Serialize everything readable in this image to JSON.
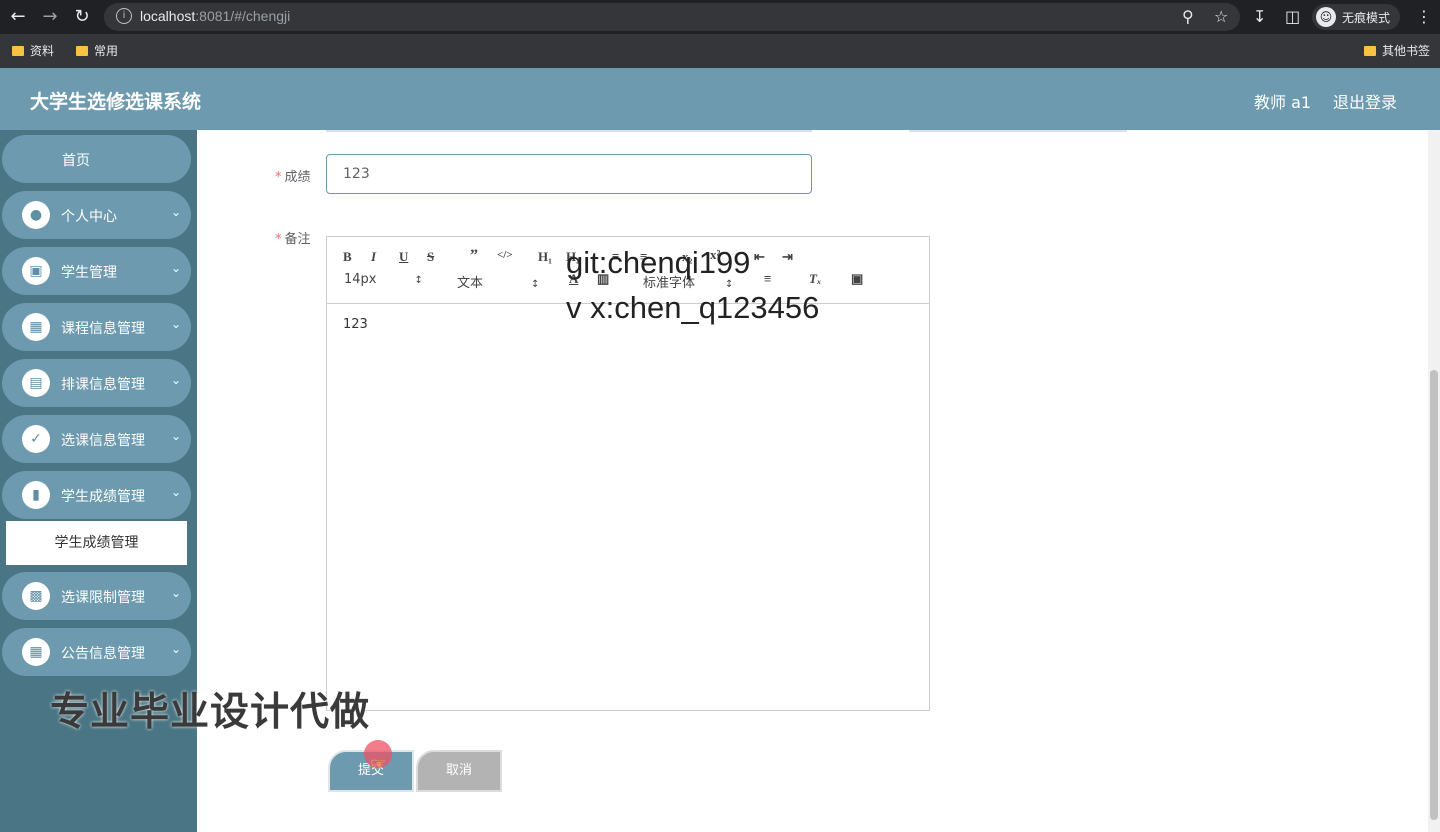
{
  "browser": {
    "url_host": "localhost",
    "url_rest": ":8081/#/chengji",
    "incognito_label": "无痕模式",
    "bookmarks": [
      "资料",
      "常用"
    ],
    "other_bookmarks": "其他书签"
  },
  "header": {
    "title": "大学生选修选课系统",
    "user": "教师 a1",
    "logout": "退出登录"
  },
  "sidebar": {
    "home": "首页",
    "items": [
      {
        "label": "个人中心",
        "icon": "person-icon"
      },
      {
        "label": "学生管理",
        "icon": "wallet-icon"
      },
      {
        "label": "课程信息管理",
        "icon": "grid-icon"
      },
      {
        "label": "排课信息管理",
        "icon": "clipboard-icon"
      },
      {
        "label": "选课信息管理",
        "icon": "clipboard-check-icon"
      },
      {
        "label": "学生成绩管理",
        "icon": "bar-chart-icon"
      },
      {
        "label": "选课限制管理",
        "icon": "monitor-icon"
      },
      {
        "label": "公告信息管理",
        "icon": "grid-icon"
      }
    ],
    "active_sub": "学生成绩管理"
  },
  "form": {
    "score_label": "成绩",
    "score_value": "123",
    "remark_label": "备注",
    "editor": {
      "font_size": "14px",
      "text_style": "文本",
      "font_family": "标准字体",
      "content": "123"
    },
    "submit_label": "提交",
    "cancel_label": "取消"
  },
  "overlay": {
    "line1": "git:chenqi199",
    "line2": "v x:chen_q123456",
    "banner": "专业毕业设计代做"
  }
}
